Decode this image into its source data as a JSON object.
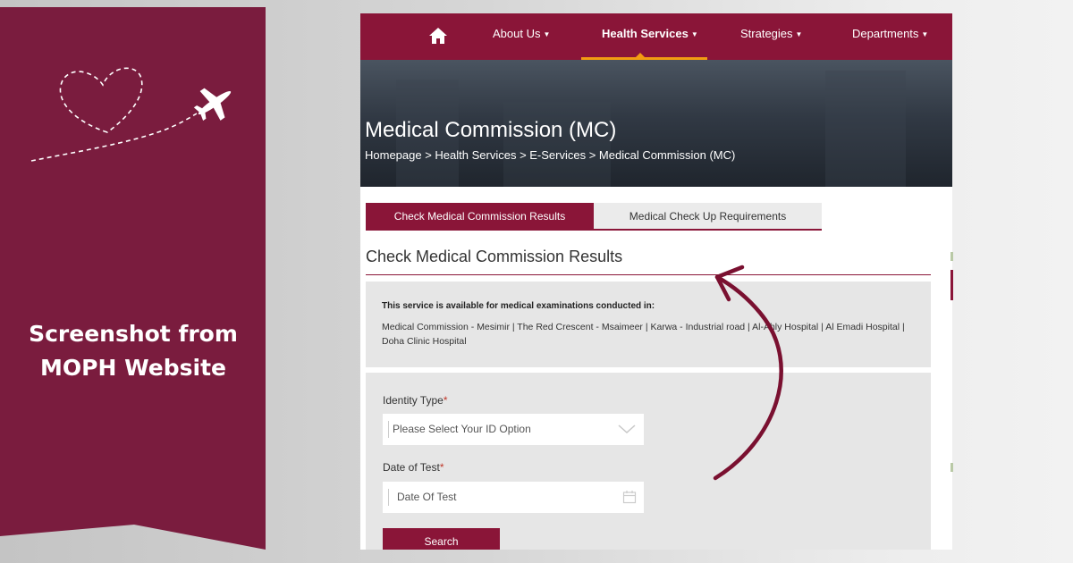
{
  "banner": {
    "caption_line1": "Screenshot from",
    "caption_line2": "MOPH Website",
    "color": "#7a1c3e"
  },
  "nav": {
    "home_icon": "home-icon",
    "items": [
      {
        "label": "About Us",
        "active": false
      },
      {
        "label": "Health Services",
        "active": true
      },
      {
        "label": "Strategies",
        "active": false
      },
      {
        "label": "Departments",
        "active": false
      }
    ],
    "color": "#8a1538",
    "accent": "#f39c12"
  },
  "hero": {
    "title": "Medical Commission (MC)",
    "breadcrumb": "Homepage > Health Services > E-Services > Medical Commission (MC)"
  },
  "tabs": [
    {
      "label": "Check Medical Commission Results",
      "active": true
    },
    {
      "label": "Medical Check Up Requirements",
      "active": false
    }
  ],
  "section": {
    "title": "Check Medical Commission Results"
  },
  "info": {
    "heading": "This service is available for medical examinations conducted in:",
    "body": "Medical Commission - Mesimir | The Red Crescent - Msaimeer | Karwa - Industrial road | Al-Ahly Hospital | Al Emadi Hospital | Doha Clinic Hospital"
  },
  "form": {
    "identity_label": "Identity Type",
    "identity_placeholder": "Please Select Your ID Option",
    "date_label": "Date of Test",
    "date_placeholder": "Date Of Test",
    "required_mark": "*",
    "search_label": "Search"
  }
}
